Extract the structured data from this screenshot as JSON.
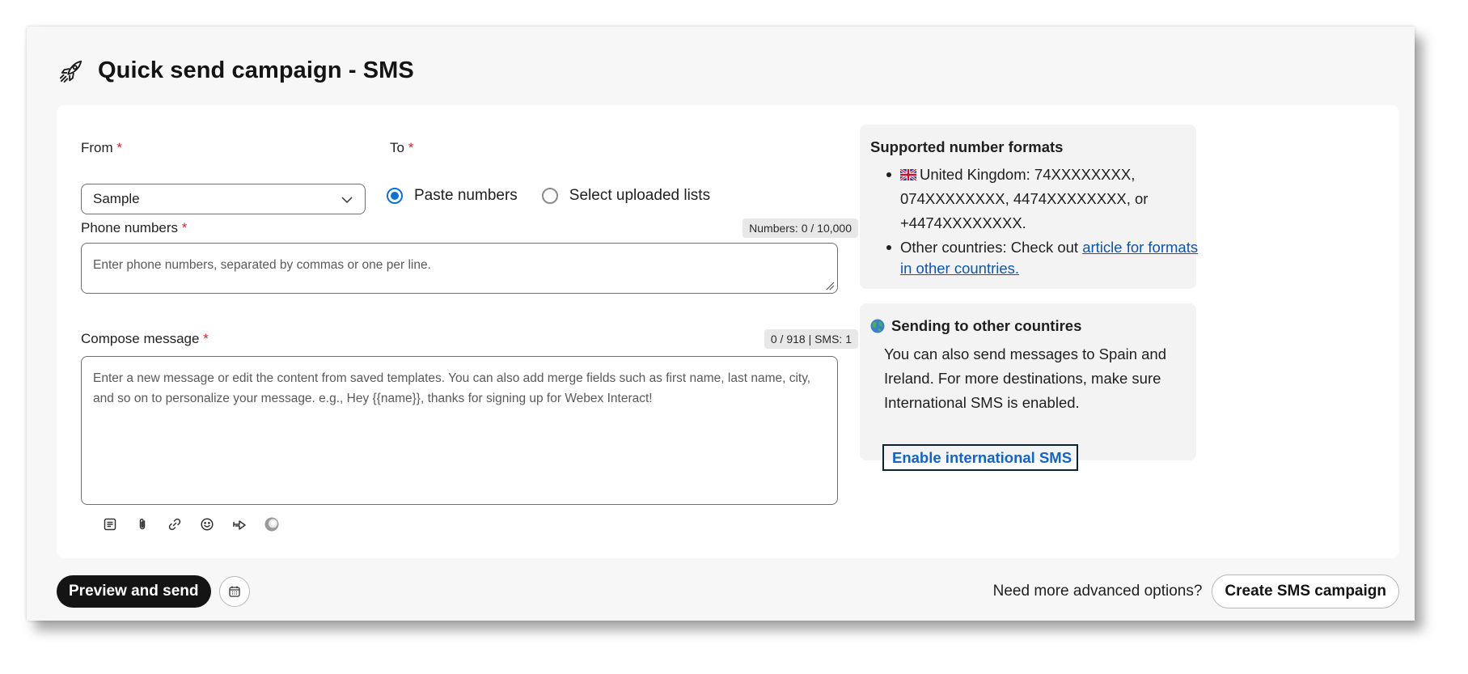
{
  "header": {
    "title": "Quick send campaign - SMS",
    "icon": "rocket-icon"
  },
  "from": {
    "label": "From",
    "required_mark": "*",
    "selected": "Sample"
  },
  "to": {
    "label": "To",
    "required_mark": "*",
    "options": [
      {
        "label": "Paste numbers",
        "checked": true
      },
      {
        "label": "Select uploaded lists",
        "checked": false
      }
    ]
  },
  "phone_numbers": {
    "label": "Phone numbers",
    "required_mark": "*",
    "counter": "Numbers: 0 / 10,000",
    "placeholder": "Enter phone numbers, separated by commas or one per line."
  },
  "compose": {
    "label": "Compose message",
    "required_mark": "*",
    "counter": "0 / 918 | SMS: 1",
    "placeholder": "Enter a new message or edit the content from saved templates. You can also add merge fields such as first name, last name, city, and so on to personalize your message. e.g., Hey {{name}}, thanks for signing up for Webex Interact!",
    "toolbar_icons": [
      "template-icon",
      "attachment-icon",
      "link-icon",
      "emoji-icon",
      "merge-field-icon",
      "ai-assist-icon"
    ]
  },
  "formats_panel": {
    "title": "Supported number formats",
    "uk_text": "United Kingdom: 74XXXXXXXX, 074XXXXXXXX, 4474XXXXXXXX, or +4474XXXXXXXX.",
    "other_prefix": "Other countries: Check out",
    "other_link": "article for formats in other countries."
  },
  "countries_panel": {
    "title": "Sending to other countires",
    "body": "You can also send messages to Spain and Ireland. For more destinations, make sure International SMS is enabled.",
    "button": "Enable international SMS"
  },
  "footer": {
    "preview_button": "Preview and send",
    "advanced_text": "Need more advanced options?",
    "create_button": "Create SMS campaign"
  },
  "colors": {
    "accent": "#1170cf",
    "link": "#0f56a6",
    "primary_button": "#141414",
    "required": "#c72626"
  }
}
